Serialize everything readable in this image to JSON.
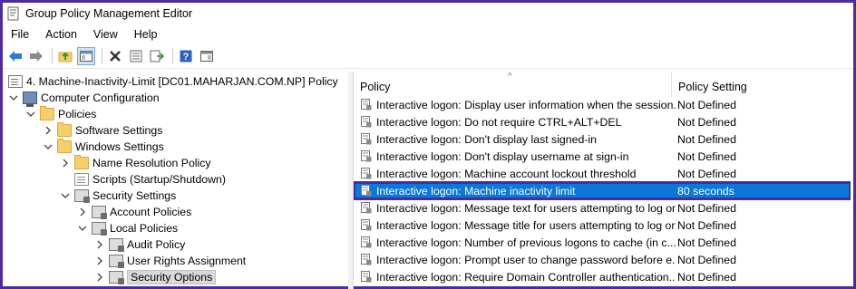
{
  "window": {
    "title": "Group Policy Management Editor"
  },
  "menu": [
    "File",
    "Action",
    "View",
    "Help"
  ],
  "toolbar": {
    "buttons": [
      {
        "name": "back-arrow-icon"
      },
      {
        "name": "forward-arrow-icon"
      },
      {
        "name": "up-folder-icon"
      },
      {
        "name": "show-hide-tree-icon"
      },
      {
        "name": "delete-icon"
      },
      {
        "name": "properties-icon"
      },
      {
        "name": "export-list-icon"
      },
      {
        "name": "help-icon"
      },
      {
        "name": "show-action-pane-icon"
      }
    ]
  },
  "tree": {
    "root": "4. Machine-Inactivity-Limit [DC01.MAHARJAN.COM.NP] Policy",
    "computer_configuration": "Computer Configuration",
    "policies": "Policies",
    "software_settings": "Software Settings",
    "windows_settings": "Windows Settings",
    "name_resolution_policy": "Name Resolution Policy",
    "scripts": "Scripts (Startup/Shutdown)",
    "security_settings": "Security Settings",
    "account_policies": "Account Policies",
    "local_policies": "Local Policies",
    "audit_policy": "Audit Policy",
    "user_rights_assignment": "User Rights Assignment",
    "security_options": "Security Options"
  },
  "list": {
    "columns": {
      "policy": "Policy",
      "setting": "Policy Setting"
    },
    "rows": [
      {
        "policy": "Interactive logon: Display user information when the session...",
        "setting": "Not Defined"
      },
      {
        "policy": "Interactive logon: Do not require CTRL+ALT+DEL",
        "setting": "Not Defined"
      },
      {
        "policy": "Interactive logon: Don't display last signed-in",
        "setting": "Not Defined"
      },
      {
        "policy": "Interactive logon: Don't display username at sign-in",
        "setting": "Not Defined"
      },
      {
        "policy": "Interactive logon: Machine account lockout threshold",
        "setting": "Not Defined"
      },
      {
        "policy": "Interactive logon: Machine inactivity limit",
        "setting": "80 seconds"
      },
      {
        "policy": "Interactive logon: Message text for users attempting to log on",
        "setting": "Not Defined"
      },
      {
        "policy": "Interactive logon: Message title for users attempting to log on",
        "setting": "Not Defined"
      },
      {
        "policy": "Interactive logon: Number of previous logons to cache (in c...",
        "setting": "Not Defined"
      },
      {
        "policy": "Interactive logon: Prompt user to change password before e...",
        "setting": "Not Defined"
      },
      {
        "policy": "Interactive logon: Require Domain Controller authentication...",
        "setting": "Not Defined"
      }
    ]
  },
  "colors": {
    "selection": "#0a78d7",
    "highlight_border": "#4b2aa3"
  }
}
